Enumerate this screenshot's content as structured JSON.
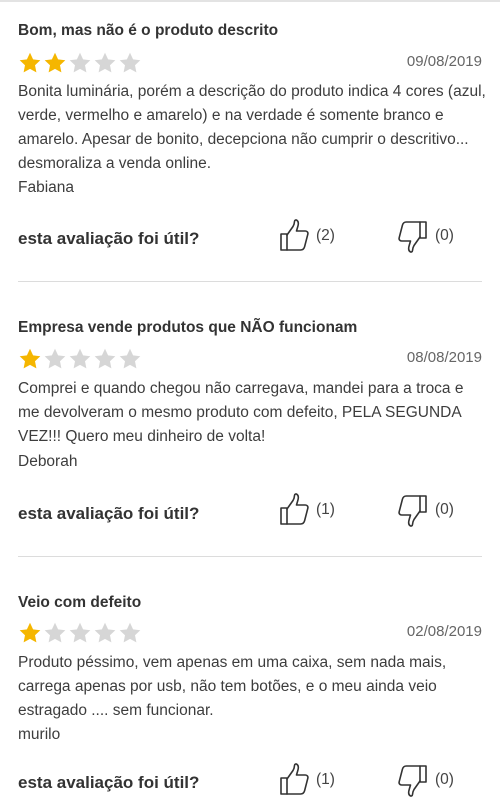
{
  "useful_question": "esta avaliação foi útil?",
  "colors": {
    "star_filled": "#f5b600",
    "star_empty": "#d6d6d6",
    "top_border": "#e3e3e3"
  },
  "icons": {
    "like": "thumbs-up-icon",
    "dislike": "thumbs-down-icon",
    "rating": "star-icon"
  },
  "reviews": [
    {
      "title": "Bom, mas não é o produto descrito",
      "rating": 2,
      "max_rating": 5,
      "date": "09/08/2019",
      "body": "Bonita luminária, porém a descrição do produto indica 4 cores (azul, verde, vermelho e amarelo) e na verdade é somente branco e amarelo. Apesar de bonito, decepciona não cumprir o descritivo... desmoraliza a venda online.",
      "author": "Fabiana",
      "likes": "(2)",
      "dislikes": "(0)"
    },
    {
      "title": "Empresa vende produtos que NÃO funcionam",
      "rating": 1,
      "max_rating": 5,
      "date": "08/08/2019",
      "body": "Comprei e quando chegou não carregava, mandei para a troca e me devolveram o mesmo produto com defeito, PELA SEGUNDA VEZ!!! Quero meu dinheiro de volta!",
      "author": "Deborah",
      "likes": "(1)",
      "dislikes": "(0)"
    },
    {
      "title": "Veio com defeito",
      "rating": 1,
      "max_rating": 5,
      "date": "02/08/2019",
      "body": "Produto péssimo, vem apenas em uma caixa, sem nada mais, carrega apenas por usb, não tem botões, e o meu ainda veio estragado .... sem funcionar.",
      "author": "murilo",
      "likes": "(1)",
      "dislikes": "(0)"
    }
  ]
}
